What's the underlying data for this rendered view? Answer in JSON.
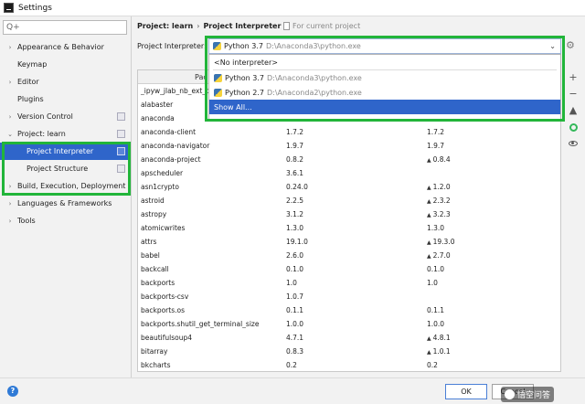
{
  "window": {
    "title": "Settings"
  },
  "search": {
    "placeholder": "Q+"
  },
  "sidebar": {
    "items": [
      {
        "label": "Appearance & Behavior",
        "chevron": "›"
      },
      {
        "label": "Keymap",
        "chevron": ""
      },
      {
        "label": "Editor",
        "chevron": "›"
      },
      {
        "label": "Plugins",
        "chevron": ""
      },
      {
        "label": "Version Control",
        "chevron": "›"
      },
      {
        "label": "Project: learn",
        "chevron": "⌄"
      },
      {
        "label": "Project Interpreter"
      },
      {
        "label": "Project Structure"
      },
      {
        "label": "Build, Execution, Deployment",
        "chevron": "›"
      },
      {
        "label": "Languages & Frameworks",
        "chevron": "›"
      },
      {
        "label": "Tools",
        "chevron": "›"
      }
    ]
  },
  "header": {
    "breadcrumb_root": "Project: learn",
    "breadcrumb_sep": "›",
    "breadcrumb_page": "Project Interpreter",
    "for_current": "For current project"
  },
  "interpreter": {
    "label": "Project Interpreter:",
    "selected_name": "Python 3.7",
    "selected_path": "D:\\Anaconda3\\python.exe",
    "arrow": "⌄"
  },
  "dropdown": {
    "no_interpreter": "<No interpreter>",
    "options": [
      {
        "name": "Python 3.7",
        "path": "D:\\Anaconda3\\python.exe"
      },
      {
        "name": "Python 2.7",
        "path": "D:\\Anaconda2\\python.exe"
      }
    ],
    "show_all": "Show All..."
  },
  "table": {
    "headers": {
      "package": "Pac",
      "version": "",
      "latest": ""
    },
    "rows": [
      {
        "pkg": "_ipyw_jlab_nb_ext_c",
        "ver": "",
        "lat": "",
        "up": false
      },
      {
        "pkg": "alabaster",
        "ver": "",
        "lat": "",
        "up": false
      },
      {
        "pkg": "anaconda",
        "ver": "",
        "lat": "",
        "up": false
      },
      {
        "pkg": "anaconda-client",
        "ver": "1.7.2",
        "lat": "1.7.2",
        "up": false
      },
      {
        "pkg": "anaconda-navigator",
        "ver": "1.9.7",
        "lat": "1.9.7",
        "up": false
      },
      {
        "pkg": "anaconda-project",
        "ver": "0.8.2",
        "lat": "0.8.4",
        "up": true
      },
      {
        "pkg": "apscheduler",
        "ver": "3.6.1",
        "lat": "",
        "up": false
      },
      {
        "pkg": "asn1crypto",
        "ver": "0.24.0",
        "lat": "1.2.0",
        "up": true
      },
      {
        "pkg": "astroid",
        "ver": "2.2.5",
        "lat": "2.3.2",
        "up": true
      },
      {
        "pkg": "astropy",
        "ver": "3.1.2",
        "lat": "3.2.3",
        "up": true
      },
      {
        "pkg": "atomicwrites",
        "ver": "1.3.0",
        "lat": "1.3.0",
        "up": false
      },
      {
        "pkg": "attrs",
        "ver": "19.1.0",
        "lat": "19.3.0",
        "up": true
      },
      {
        "pkg": "babel",
        "ver": "2.6.0",
        "lat": "2.7.0",
        "up": true
      },
      {
        "pkg": "backcall",
        "ver": "0.1.0",
        "lat": "0.1.0",
        "up": false
      },
      {
        "pkg": "backports",
        "ver": "1.0",
        "lat": "1.0",
        "up": false
      },
      {
        "pkg": "backports-csv",
        "ver": "1.0.7",
        "lat": "",
        "up": false
      },
      {
        "pkg": "backports.os",
        "ver": "0.1.1",
        "lat": "0.1.1",
        "up": false
      },
      {
        "pkg": "backports.shutil_get_terminal_size",
        "ver": "1.0.0",
        "lat": "1.0.0",
        "up": false
      },
      {
        "pkg": "beautifulsoup4",
        "ver": "4.7.1",
        "lat": "4.8.1",
        "up": true
      },
      {
        "pkg": "bitarray",
        "ver": "0.8.3",
        "lat": "1.0.1",
        "up": true
      },
      {
        "pkg": "bkcharts",
        "ver": "0.2",
        "lat": "0.2",
        "up": false
      }
    ]
  },
  "toolbar": {
    "add_icon": "+",
    "remove_icon": "−",
    "upgrade_icon": "▲",
    "gear_icon": "⚙"
  },
  "footer": {
    "help": "?",
    "ok": "OK",
    "cancel": "Cancel"
  },
  "watermark": {
    "text": "悟空问答"
  },
  "icons": {
    "up_arrow": "▲",
    "search": "⚲"
  }
}
